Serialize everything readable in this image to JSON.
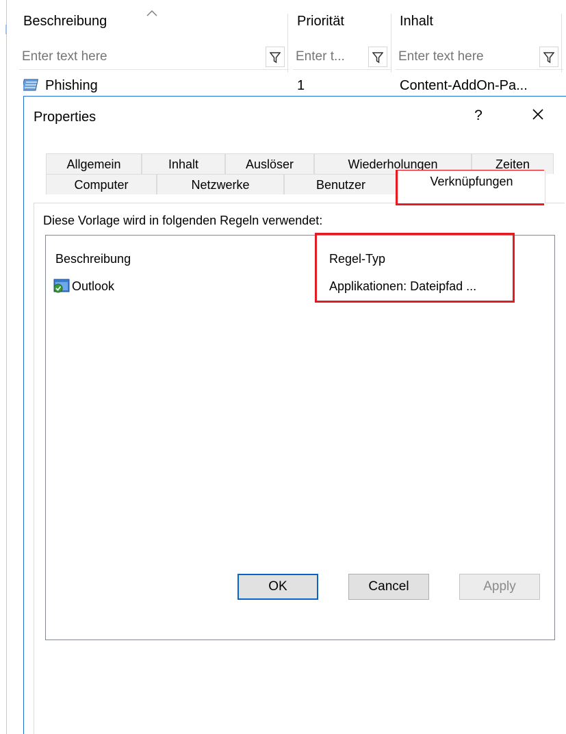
{
  "grid": {
    "columns": [
      {
        "label": "Beschreibung",
        "filter_placeholder": "Enter text here"
      },
      {
        "label": "Priorität",
        "filter_placeholder": "Enter t..."
      },
      {
        "label": "Inhalt",
        "filter_placeholder": "Enter text here"
      }
    ],
    "row": {
      "beschreibung": "Phishing",
      "prioritaet": "1",
      "inhalt": "Content-AddOn-Pa..."
    }
  },
  "dialog": {
    "title": "Properties",
    "help_label": "?",
    "close_label": "✕",
    "tabs_row1": [
      "Allgemein",
      "Inhalt",
      "Auslöser",
      "Wiederholungen",
      "Zeiten"
    ],
    "tabs_row2": [
      "Computer",
      "Netzwerke",
      "Benutzer",
      "Verknüpfungen"
    ],
    "active_tab": "Verknüpfungen",
    "caption": "Diese Vorlage wird in folgenden Regeln verwendet:",
    "list": {
      "headers": {
        "beschreibung": "Beschreibung",
        "regel_typ": "Regel-Typ"
      },
      "rows": [
        {
          "beschreibung": "Outlook",
          "regel_typ": "Applikationen: Dateipfad ..."
        }
      ]
    },
    "buttons": {
      "ok": "OK",
      "cancel": "Cancel",
      "apply": "Apply"
    }
  },
  "colors": {
    "highlight": "#e41b23",
    "dialog_border": "#1e6fd1",
    "default_button_border": "#0a64c8"
  }
}
